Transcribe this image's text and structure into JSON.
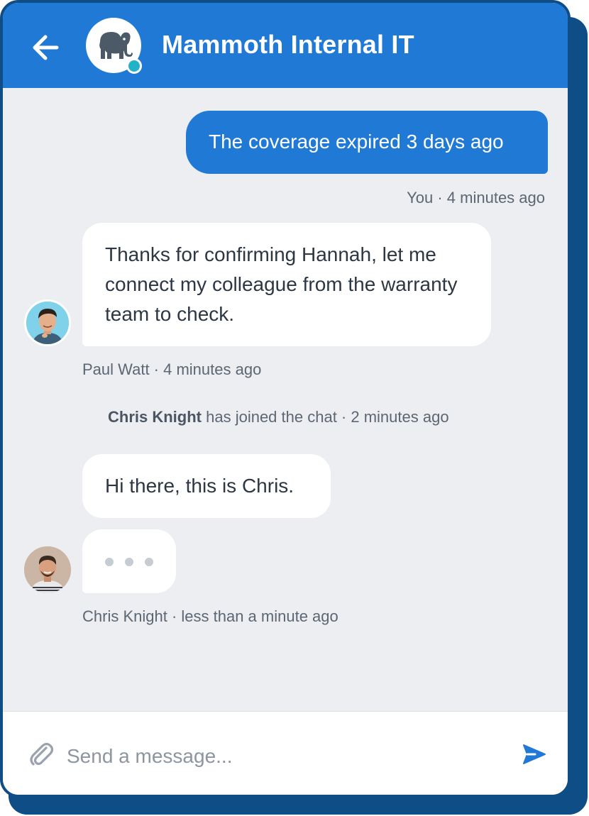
{
  "header": {
    "title": "Mammoth Internal IT",
    "brand_icon": "elephant-icon",
    "status": "online"
  },
  "messages": {
    "outgoing_text": "The coverage expired 3 days ago",
    "outgoing_meta": "You · 4 minutes ago",
    "paul_text": "Thanks for confirming Hannah, let me connect my colleague from the warranty team to check.",
    "paul_meta": "Paul Watt · 4 minutes ago",
    "system_name": "Chris Knight",
    "system_rest": " has joined the chat · 2 minutes ago",
    "chris_text": "Hi there, this is Chris.",
    "chris_meta": "Chris Knight · less than a minute ago"
  },
  "composer": {
    "placeholder": "Send a message...",
    "value": ""
  },
  "colors": {
    "brand": "#2079d4",
    "frame": "#0e4d86",
    "chat_bg": "#eceef1",
    "online": "#22b3c8"
  }
}
